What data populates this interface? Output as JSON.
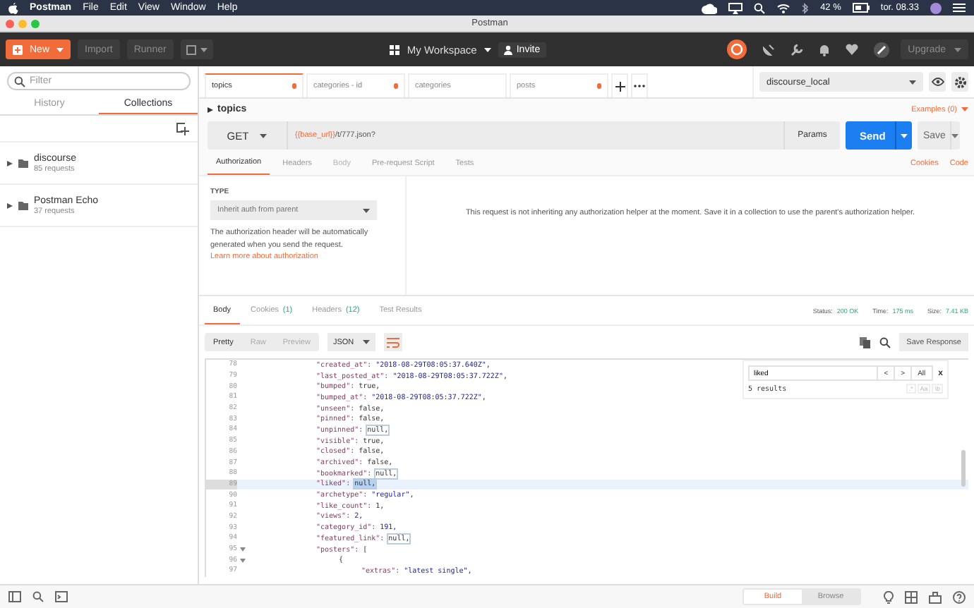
{
  "menubar": {
    "app": "Postman",
    "menus": [
      "File",
      "Edit",
      "View",
      "Window",
      "Help"
    ],
    "battery": "42 %",
    "clock": "tor. 08.33"
  },
  "window": {
    "title": "Postman"
  },
  "toolbar": {
    "new": "New",
    "import": "Import",
    "runner": "Runner",
    "workspace": "My Workspace",
    "invite": "Invite",
    "upgrade": "Upgrade"
  },
  "sidebar": {
    "filter_placeholder": "Filter",
    "tabs": [
      {
        "label": "History",
        "selected": false
      },
      {
        "label": "Collections",
        "selected": true
      }
    ],
    "collections": [
      {
        "name": "discourse",
        "count": "85 requests"
      },
      {
        "name": "Postman Echo",
        "count": "37 requests"
      }
    ]
  },
  "request_tabs": [
    {
      "label": "topics",
      "selected": true,
      "modified": true
    },
    {
      "label": "categories - id",
      "selected": false,
      "modified": true
    },
    {
      "label": "categories",
      "selected": false,
      "modified": false
    },
    {
      "label": "posts",
      "selected": false,
      "modified": true
    }
  ],
  "environment": "discourse_local",
  "request": {
    "name": "topics",
    "examples": "Examples (0)",
    "method": "GET",
    "url_variable": "{{base_url}}",
    "url_path": "/t/777.json?",
    "params": "Params",
    "send": "Send",
    "save": "Save"
  },
  "request_sections": [
    {
      "label": "Authorization",
      "selected": true,
      "disabled": false
    },
    {
      "label": "Headers",
      "selected": false,
      "disabled": false
    },
    {
      "label": "Body",
      "selected": false,
      "disabled": true
    },
    {
      "label": "Pre-request Script",
      "selected": false,
      "disabled": false
    },
    {
      "label": "Tests",
      "selected": false,
      "disabled": false
    }
  ],
  "request_links": [
    "Cookies",
    "Code"
  ],
  "auth": {
    "type_label": "TYPE",
    "type_value": "Inherit auth from parent",
    "help": "The authorization header will be automatically generated when you send the request.",
    "help_link": "Learn more about authorization",
    "message": "This request is not inheriting any authorization helper at the moment. Save it in a collection to use the parent's authorization helper."
  },
  "response_tabs": [
    {
      "label": "Body",
      "selected": true
    },
    {
      "label": "Cookies",
      "count": "(1)",
      "selected": false
    },
    {
      "label": "Headers",
      "count": "(12)",
      "selected": false
    },
    {
      "label": "Test Results",
      "selected": false
    }
  ],
  "response_stats": [
    {
      "label": "Status:",
      "value": "200 OK"
    },
    {
      "label": "Time:",
      "value": "175 ms"
    },
    {
      "label": "Size:",
      "value": "7.41 KB"
    }
  ],
  "view_modes": [
    {
      "label": "Pretty",
      "selected": true
    },
    {
      "label": "Raw",
      "selected": false
    },
    {
      "label": "Preview",
      "selected": false
    }
  ],
  "format": "JSON",
  "save_response": "Save Response",
  "code_lines": [
    {
      "number": "78",
      "kind": "field",
      "key": "\"created_at\":",
      "value": "\"2018-08-29T08:05:37.640Z\",",
      "colored_value": true,
      "current": false,
      "marked": false,
      "foldable": false
    },
    {
      "number": "79",
      "kind": "field",
      "key": "\"last_posted_at\":",
      "value": "\"2018-08-29T08:05:37.722Z\",",
      "colored_value": true,
      "current": false,
      "marked": false,
      "foldable": false
    },
    {
      "number": "80",
      "kind": "field",
      "key": "\"bumped\":",
      "value": "true,",
      "colored_value": false,
      "current": false,
      "marked": false,
      "foldable": false
    },
    {
      "number": "81",
      "kind": "field",
      "key": "\"bumped_at\":",
      "value": "\"2018-08-29T08:05:37.722Z\",",
      "colored_value": true,
      "current": false,
      "marked": false,
      "foldable": false
    },
    {
      "number": "82",
      "kind": "field",
      "key": "\"unseen\":",
      "value": "false,",
      "colored_value": false,
      "current": false,
      "marked": false,
      "foldable": false
    },
    {
      "number": "83",
      "kind": "field",
      "key": "\"pinned\":",
      "value": "false,",
      "colored_value": false,
      "current": false,
      "marked": false,
      "foldable": false
    },
    {
      "number": "84",
      "kind": "field",
      "key": "\"unpinned\":",
      "value": "null,",
      "colored_value": false,
      "current": false,
      "marked": true,
      "foldable": false
    },
    {
      "number": "85",
      "kind": "field",
      "key": "\"visible\":",
      "value": "true,",
      "colored_value": false,
      "current": false,
      "marked": false,
      "foldable": false
    },
    {
      "number": "86",
      "kind": "field",
      "key": "\"closed\":",
      "value": "false,",
      "colored_value": false,
      "current": false,
      "marked": false,
      "foldable": false
    },
    {
      "number": "87",
      "kind": "field",
      "key": "\"archived\":",
      "value": "false,",
      "colored_value": false,
      "current": false,
      "marked": false,
      "foldable": false
    },
    {
      "number": "88",
      "kind": "field",
      "key": "\"bookmarked\":",
      "value": "null,",
      "colored_value": false,
      "current": false,
      "marked": true,
      "foldable": false
    },
    {
      "number": "89",
      "kind": "field",
      "key": "\"liked\":",
      "value": "null,",
      "colored_value": false,
      "current": true,
      "marked": true,
      "foldable": false
    },
    {
      "number": "90",
      "kind": "field",
      "key": "\"archetype\":",
      "value": "\"regular\",",
      "colored_value": true,
      "current": false,
      "marked": false,
      "foldable": false
    },
    {
      "number": "91",
      "kind": "field",
      "key": "\"like_count\":",
      "value": "1,",
      "colored_value": true,
      "current": false,
      "marked": false,
      "foldable": false
    },
    {
      "number": "92",
      "kind": "field",
      "key": "\"views\":",
      "value": "2,",
      "colored_value": true,
      "current": false,
      "marked": false,
      "foldable": false
    },
    {
      "number": "93",
      "kind": "field",
      "key": "\"category_id\":",
      "value": "191,",
      "colored_value": true,
      "current": false,
      "marked": false,
      "foldable": false
    },
    {
      "number": "94",
      "kind": "field",
      "key": "\"featured_link\":",
      "value": "null,",
      "colored_value": false,
      "current": false,
      "marked": true,
      "foldable": false
    },
    {
      "number": "95",
      "kind": "field",
      "key": "\"posters\":",
      "value": "[",
      "colored_value": false,
      "current": false,
      "marked": false,
      "foldable": true
    },
    {
      "number": "96",
      "kind": "object",
      "value": "{",
      "colored_value": false,
      "current": false,
      "marked": false,
      "foldable": true
    },
    {
      "number": "97",
      "kind": "nested",
      "key": "\"extras\":",
      "value": "\"latest single\",",
      "colored_value": true,
      "current": false,
      "marked": false,
      "foldable": false
    }
  ],
  "find": {
    "value": "liked",
    "prev": "<",
    "next": ">",
    "all": "All",
    "close": "x",
    "results": "5 results",
    "options": [
      ".*",
      "Aa",
      "\\b"
    ]
  },
  "statusbar": {
    "modes": [
      {
        "label": "Build",
        "selected": true
      },
      {
        "label": "Browse",
        "selected": false
      }
    ]
  }
}
